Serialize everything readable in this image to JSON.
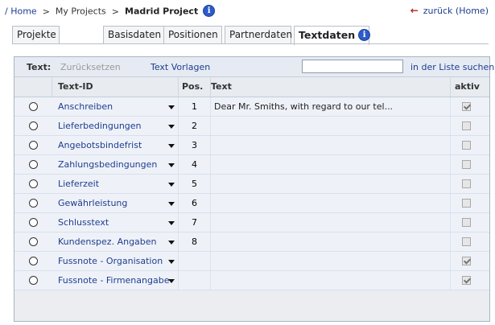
{
  "breadcrumb": {
    "home": "/ Home",
    "sep1": ">",
    "projects": "My Projects",
    "sep2": ">",
    "current": "Madrid Project"
  },
  "back": {
    "arrow": "←",
    "label": "zurück (Home)"
  },
  "tabs": [
    {
      "label": "Projekte",
      "active": false
    },
    {
      "label": "Basisdaten",
      "active": false
    },
    {
      "label": "Positionen",
      "active": false
    },
    {
      "label": "Partnerdaten",
      "active": false
    },
    {
      "label": "Textdaten",
      "active": true
    }
  ],
  "info_glyph": "i",
  "toolbar": {
    "label": "Text:",
    "reset": "Zurücksetzen",
    "templates": "Text Vorlagen",
    "search_value": "",
    "search_button": "in der Liste suchen"
  },
  "columns": {
    "id": "Text-ID",
    "pos": "Pos.",
    "text": "Text",
    "active": "aktiv"
  },
  "rows": [
    {
      "id": "Anschreiben",
      "pos": "1",
      "text": "Dear Mr. Smiths, with regard to our tel...",
      "active": true
    },
    {
      "id": "Lieferbedingungen",
      "pos": "2",
      "text": "",
      "active": false
    },
    {
      "id": "Angebotsbindefrist",
      "pos": "3",
      "text": "",
      "active": false
    },
    {
      "id": "Zahlungsbedingungen",
      "pos": "4",
      "text": "",
      "active": false
    },
    {
      "id": "Lieferzeit",
      "pos": "5",
      "text": "",
      "active": false
    },
    {
      "id": "Gewährleistung",
      "pos": "6",
      "text": "",
      "active": false
    },
    {
      "id": "Schlusstext",
      "pos": "7",
      "text": "",
      "active": false
    },
    {
      "id": "Kundenspez. Angaben",
      "pos": "8",
      "text": "",
      "active": false
    },
    {
      "id": "Fussnote - Organisation",
      "pos": "",
      "text": "",
      "active": true
    },
    {
      "id": "Fussnote - Firmenangabe",
      "pos": "",
      "text": "",
      "active": true
    }
  ]
}
